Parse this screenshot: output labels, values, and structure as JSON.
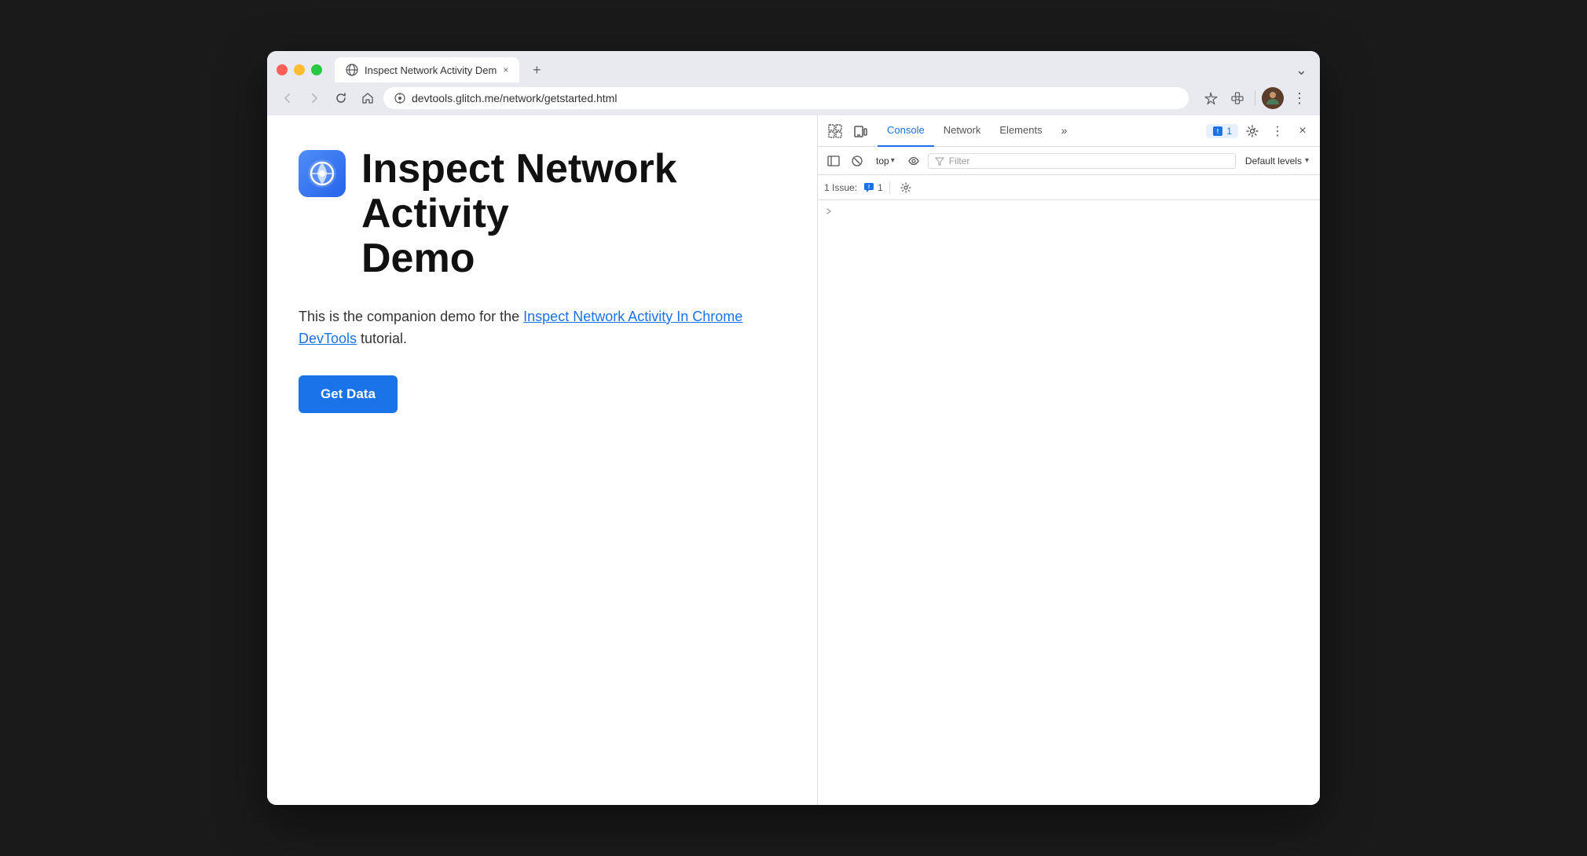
{
  "browser": {
    "tab_title": "Inspect Network Activity Dem",
    "tab_close": "×",
    "tab_new": "+",
    "tab_dropdown": "⌄",
    "back_disabled": true,
    "forward_disabled": true,
    "reload": "↺",
    "home": "⌂",
    "url": "devtools.glitch.me/network/getstarted.html",
    "url_icon": "🔒",
    "bookmark_icon": "☆",
    "extension_icon": "🧩",
    "menu_icon": "⋮",
    "avatar_alt": "user avatar"
  },
  "page": {
    "title_line1": "Inspect Network Activity",
    "title_line2": "Demo",
    "description_before": "This is the companion demo for the ",
    "link_text": "Inspect Network Activity In Chrome DevTools",
    "description_after": " tutorial.",
    "button_label": "Get Data"
  },
  "devtools": {
    "toolbar1": {
      "select_icon": "⊡",
      "device_icon": "▭",
      "tabs": [
        "Console",
        "Network",
        "Elements"
      ],
      "active_tab": "Console",
      "more_tabs": "»",
      "issues_count": "1",
      "settings_icon": "⚙",
      "more_icon": "⋮",
      "close_icon": "×"
    },
    "toolbar2": {
      "sidebar_icon": "▭",
      "clear_icon": "🚫",
      "context_label": "top",
      "context_dropdown": "▾",
      "eye_icon": "👁",
      "filter_placeholder": "Filter",
      "levels_label": "Default levels",
      "levels_dropdown": "▾"
    },
    "issues_bar": {
      "issues_label": "1 Issue:",
      "issue_icon": "💬",
      "issue_count": "1",
      "settings_icon": "⚙"
    },
    "console": {
      "has_chevron": true
    }
  },
  "colors": {
    "accent_blue": "#1a73e8",
    "devtools_blue": "#1a73e8",
    "title_bg": "#e8eaf0",
    "tab_active_bg": "#ffffff",
    "site_icon_bg": "#4f8ef7"
  }
}
